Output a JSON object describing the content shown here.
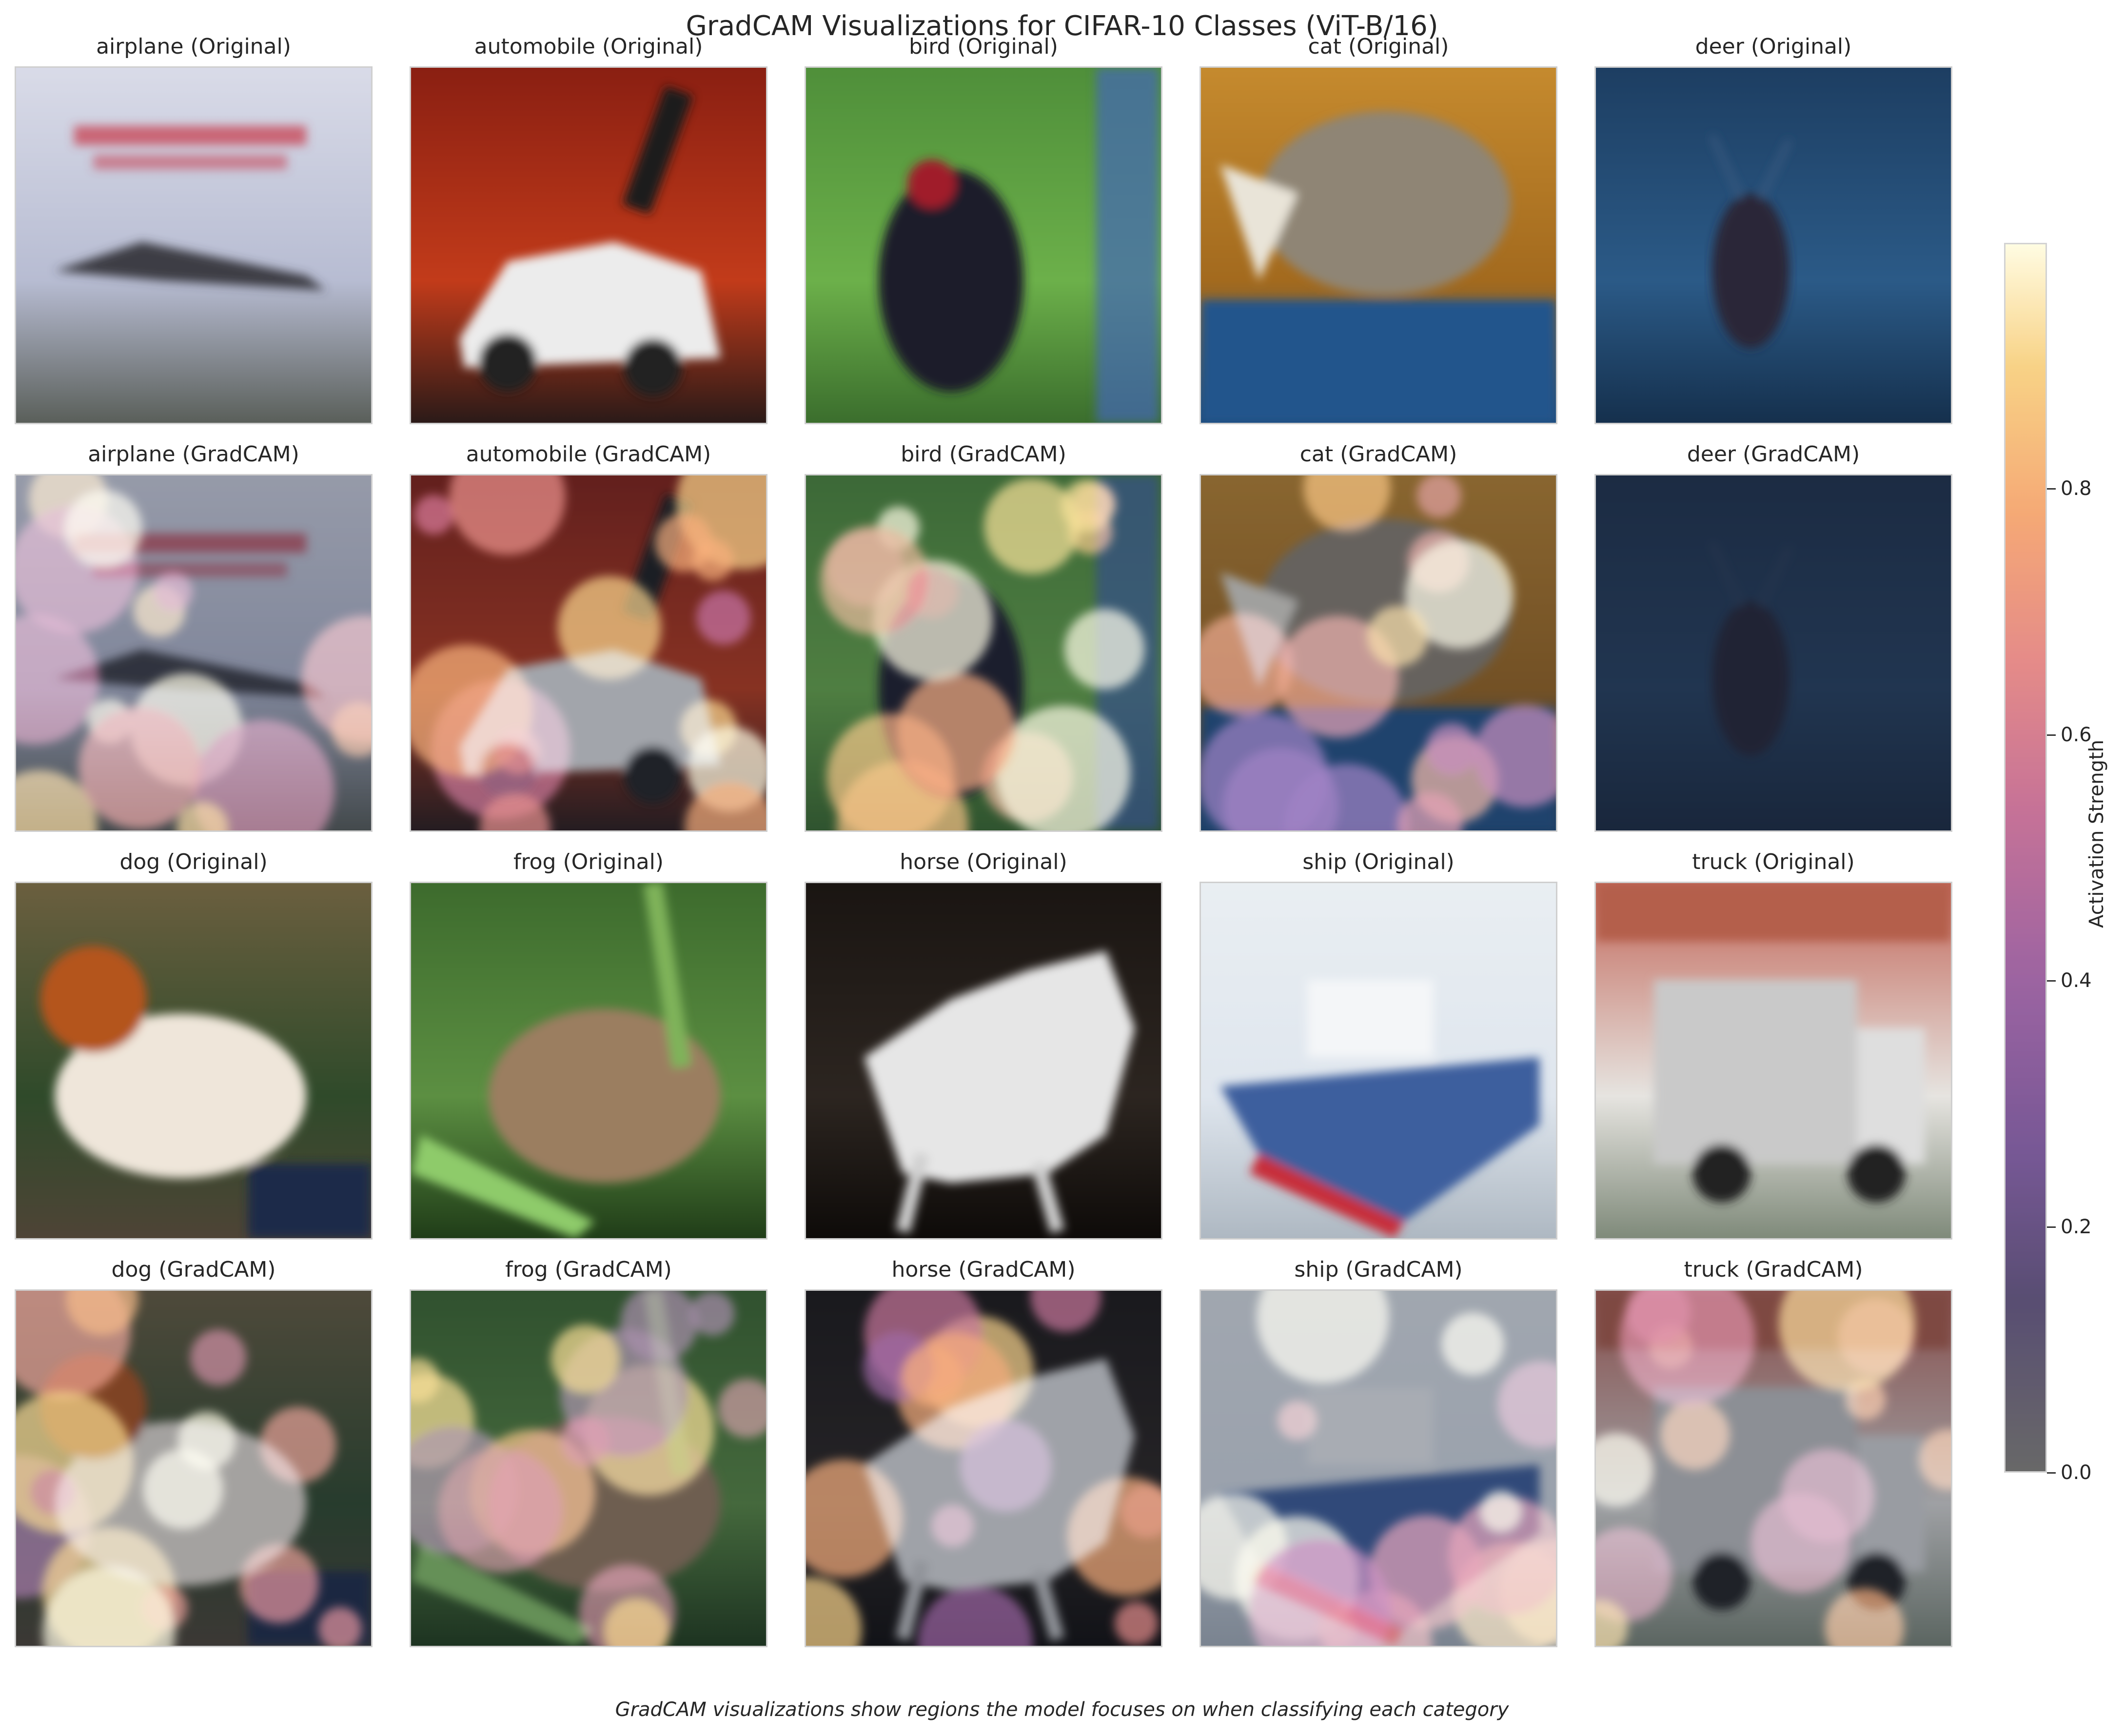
{
  "figure": {
    "title": "GradCAM Visualizations for CIFAR-10 Classes (ViT-B/16)",
    "caption": "GradCAM visualizations show regions the model focuses on when classifying each category"
  },
  "panels": [
    {
      "title": "airplane (Original)",
      "kind": "original",
      "subject": "airplane"
    },
    {
      "title": "automobile (Original)",
      "kind": "original",
      "subject": "automobile"
    },
    {
      "title": "bird (Original)",
      "kind": "original",
      "subject": "bird"
    },
    {
      "title": "cat (Original)",
      "kind": "original",
      "subject": "cat"
    },
    {
      "title": "deer (Original)",
      "kind": "original",
      "subject": "deer"
    },
    {
      "title": "airplane (GradCAM)",
      "kind": "gradcam",
      "subject": "airplane"
    },
    {
      "title": "automobile (GradCAM)",
      "kind": "gradcam",
      "subject": "automobile"
    },
    {
      "title": "bird (GradCAM)",
      "kind": "gradcam",
      "subject": "bird"
    },
    {
      "title": "cat (GradCAM)",
      "kind": "gradcam",
      "subject": "cat"
    },
    {
      "title": "deer (GradCAM)",
      "kind": "gradcam",
      "subject": "deer"
    },
    {
      "title": "dog (Original)",
      "kind": "original",
      "subject": "dog"
    },
    {
      "title": "frog (Original)",
      "kind": "original",
      "subject": "frog"
    },
    {
      "title": "horse (Original)",
      "kind": "original",
      "subject": "horse"
    },
    {
      "title": "ship (Original)",
      "kind": "original",
      "subject": "ship"
    },
    {
      "title": "truck (Original)",
      "kind": "original",
      "subject": "truck"
    },
    {
      "title": "dog (GradCAM)",
      "kind": "gradcam",
      "subject": "dog"
    },
    {
      "title": "frog (GradCAM)",
      "kind": "gradcam",
      "subject": "frog"
    },
    {
      "title": "horse (GradCAM)",
      "kind": "gradcam",
      "subject": "horse"
    },
    {
      "title": "ship (GradCAM)",
      "kind": "gradcam",
      "subject": "ship"
    },
    {
      "title": "truck (GradCAM)",
      "kind": "gradcam",
      "subject": "truck"
    }
  ],
  "colorbar": {
    "label": "Activation Strength",
    "range": [
      0.0,
      1.0
    ],
    "ticks": [
      "0.0",
      "0.2",
      "0.4",
      "0.6",
      "0.8"
    ],
    "tick_values": [
      0.0,
      0.2,
      0.4,
      0.6,
      0.8
    ],
    "colormap": "inferno-like",
    "colors": {
      "low": "#5c5c5c",
      "mid": "#94579a",
      "high": "#fffce0"
    }
  }
}
